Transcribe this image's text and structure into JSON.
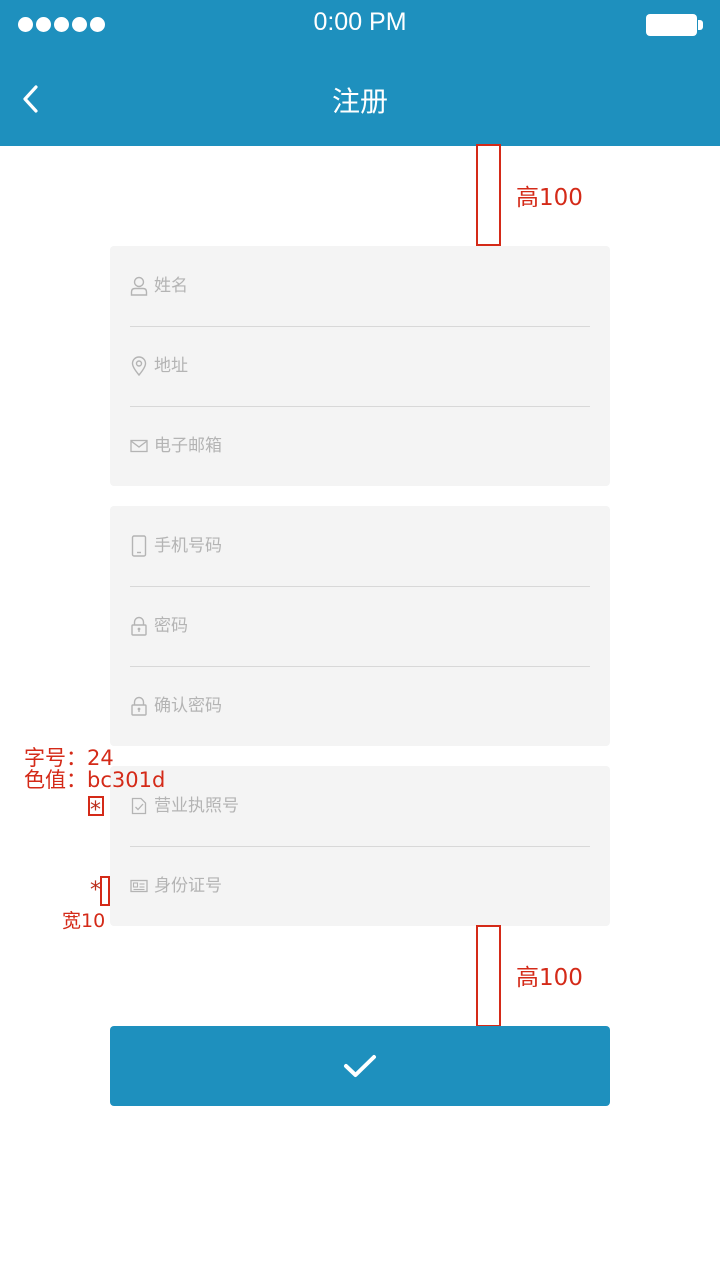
{
  "status_bar": {
    "time": "0:00 PM"
  },
  "header": {
    "title": "注册"
  },
  "groups": [
    {
      "fields": [
        {
          "placeholder": "姓名",
          "icon": "user-icon"
        },
        {
          "placeholder": "地址",
          "icon": "location-pin-icon"
        },
        {
          "placeholder": "电子邮箱",
          "icon": "mail-icon"
        }
      ]
    },
    {
      "fields": [
        {
          "placeholder": "手机号码",
          "icon": "phone-icon"
        },
        {
          "placeholder": "密码",
          "icon": "lock-icon"
        },
        {
          "placeholder": "确认密码",
          "icon": "lock-icon"
        }
      ]
    },
    {
      "fields": [
        {
          "placeholder": "营业执照号",
          "icon": "license-icon"
        },
        {
          "placeholder": "身份证号",
          "icon": "id-card-icon"
        }
      ]
    }
  ],
  "annotations": {
    "top_gap": "高100",
    "bottom_gap": "高100",
    "font_size": "字号：24",
    "color_value": "色值：bc301d",
    "asterisk": "*",
    "width": "宽10"
  },
  "colors": {
    "primary": "#1e90be",
    "annotation": "#d42a18",
    "asterisk": "#bc301d"
  },
  "submit": {
    "icon": "check-icon"
  }
}
